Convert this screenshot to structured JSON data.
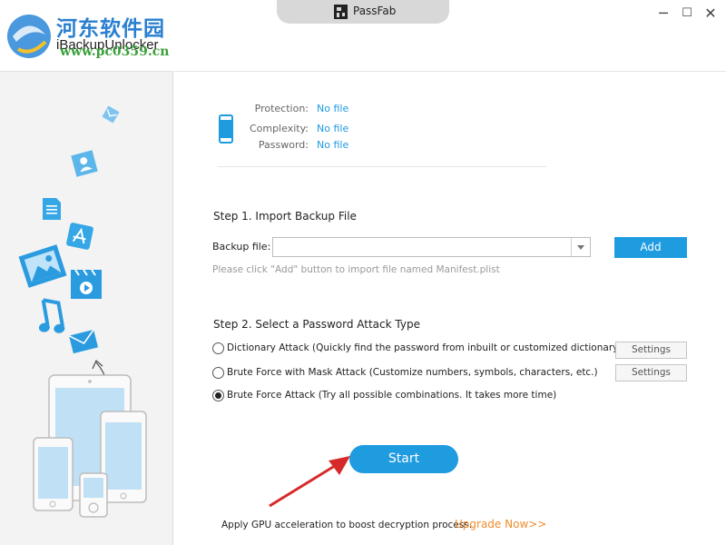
{
  "window": {
    "brand": "PassFab",
    "app_title": "iBackupUnlocker",
    "minimize": "─",
    "maximize": "☐",
    "close": "✕"
  },
  "watermark": {
    "site_name": "河东软件园",
    "url": "www.pc0359.cn"
  },
  "info": {
    "protection_label": "Protection:",
    "protection_value": "No file",
    "complexity_label": "Complexity:",
    "complexity_value": "No file",
    "password_label": "Password:",
    "password_value": "No file"
  },
  "step1": {
    "title": "Step 1. Import Backup File",
    "field_label": "Backup file:",
    "value": "",
    "add_label": "Add",
    "hint": "Please click \"Add\" button to import file named Manifest.plist"
  },
  "step2": {
    "title": "Step 2. Select a Password Attack Type",
    "options": [
      {
        "label": "Dictionary Attack (Quickly find the password from inbuilt or customized dictionary.)",
        "checked": false,
        "settings": "Settings"
      },
      {
        "label": "Brute Force with Mask Attack (Customize numbers, symbols, characters, etc.)",
        "checked": false,
        "settings": "Settings"
      },
      {
        "label": "Brute Force Attack (Try all possible combinations. It takes more time)",
        "checked": true
      }
    ]
  },
  "start_label": "Start",
  "footer": {
    "gpu_text": "Apply GPU acceleration to boost decryption process.",
    "upgrade_label": "Upgrade Now>>"
  },
  "colors": {
    "accent": "#1f9be0",
    "link_orange": "#f08b2c",
    "sidebar_bg": "#f3f3f3",
    "arrow_red": "#d62a2a"
  },
  "icons": {
    "sidebar": [
      "email-icon",
      "contact-icon",
      "document-icon",
      "app-store-icon",
      "photo-icon",
      "video-icon",
      "music-icon",
      "mail-icon",
      "curved-arrow-icon",
      "devices-illustration"
    ],
    "main": [
      "phone-icon"
    ]
  }
}
